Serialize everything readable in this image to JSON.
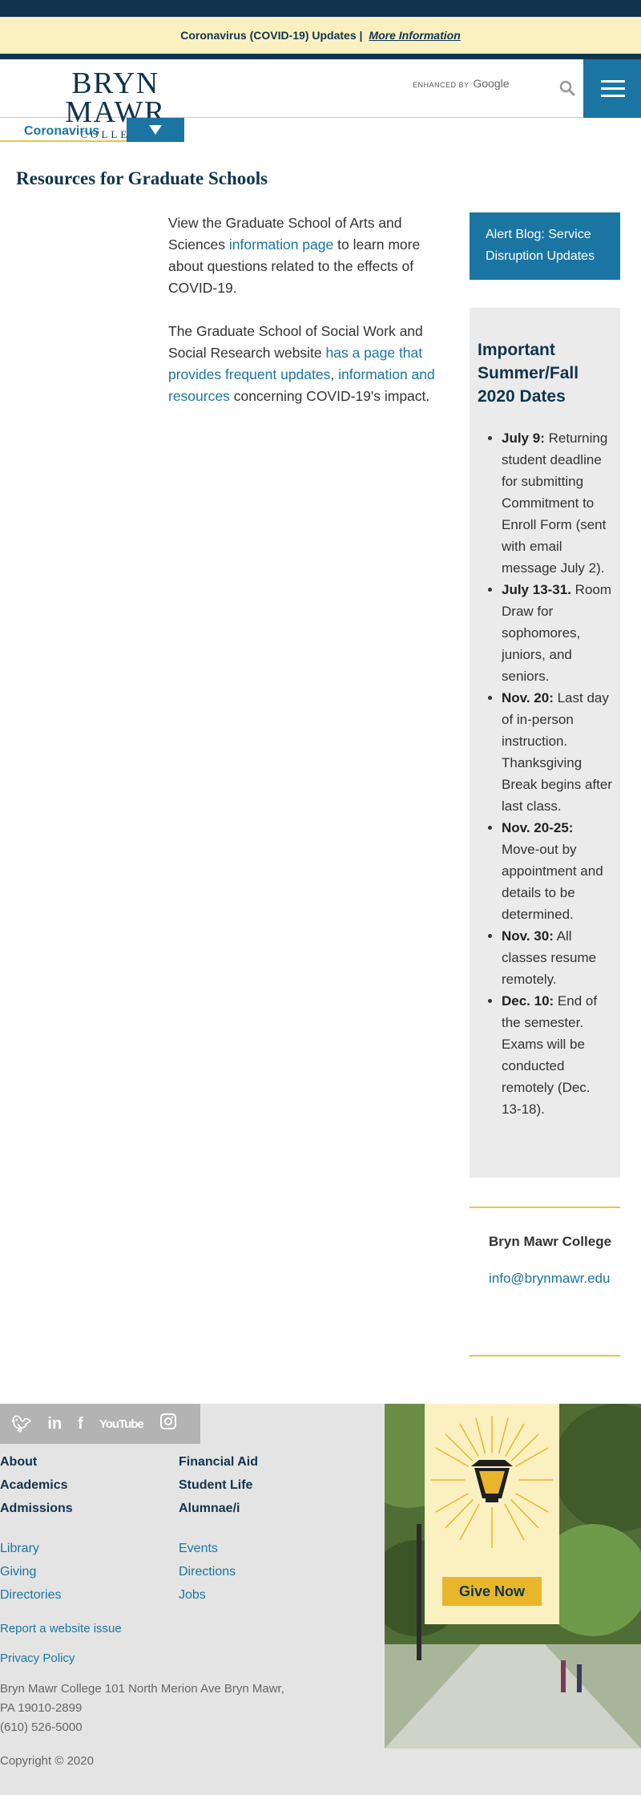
{
  "alert": {
    "text": "Coronavirus (COVID-19) Updates |",
    "link": "More Information"
  },
  "header": {
    "logo_line1": "BRYN MAWR",
    "logo_line2": "COLLEGE",
    "search_enhanced": "ENHANCED BY",
    "search_provider": "Google",
    "search_icon": "search-icon",
    "menu_icon": "hamburger-icon"
  },
  "subnav": {
    "label": "Coronavirus",
    "toggle_icon": "chevron-down-icon"
  },
  "page": {
    "title": "Resources for Graduate Schools"
  },
  "main": {
    "p1_before": "View the Graduate School of Arts and Sciences ",
    "p1_link": "information page",
    "p1_after": " to learn more about questions related to the effects of COVID-19.",
    "p2_before": "The Graduate School of Social Work and Social Research website ",
    "p2_link1": "has a page that provides frequent updates",
    "p2_sep": ", ",
    "p2_link2": "information and resources",
    "p2_after": " concerning COVID-19's impact."
  },
  "sidebar": {
    "blog_button": "Alert Blog: Service Disruption Updates",
    "dates_title": "Important Summer/Fall 2020 Dates",
    "dates": [
      {
        "date": "July 9:",
        "text": " Returning student deadline for submitting Commitment to Enroll Form (sent with email message July 2)."
      },
      {
        "date": "July 13-31.",
        "text": " Room Draw for sophomores, juniors, and seniors."
      },
      {
        "date": "Nov. 20:",
        "text": " Last day of in-person instruction. Thanksgiving Break begins after last class."
      },
      {
        "date": "Nov. 20-25:",
        "text": " Move-out by appointment and details to be determined."
      },
      {
        "date": "Nov. 30:",
        "text": " All classes resume remotely."
      },
      {
        "date": "Dec. 10:",
        "text": " End of the semester. Exams will be conducted remotely (Dec. 13-18)."
      }
    ],
    "contact_name": "Bryn Mawr College",
    "contact_email": "info@brynmawr.edu"
  },
  "footer": {
    "social": {
      "twitter": "twitter-icon",
      "linkedin": "linkedin-icon",
      "facebook": "facebook-icon",
      "youtube": "YouTube",
      "instagram": "instagram-icon"
    },
    "col1_bold": [
      "About",
      "Academics",
      "Admissions"
    ],
    "col2_bold": [
      "Financial Aid",
      "Student Life",
      "Alumnae/i"
    ],
    "col1_links": [
      "Library",
      "Giving",
      "Directories"
    ],
    "col2_links": [
      "Events",
      "Directions",
      "Jobs"
    ],
    "report_issue": "Report a website issue",
    "privacy": "Privacy Policy",
    "address_line1": "Bryn Mawr College 101 North Merion Ave Bryn Mawr,",
    "address_line2": "PA 19010-2899",
    "phone": "(610) 526-5000",
    "copyright": "Copyright © 2020",
    "give_button": "Give Now",
    "give_icon": "lantern-icon"
  },
  "colors": {
    "navy": "#10344e",
    "blue": "#1a75a3",
    "gold": "#e8c34a",
    "cream": "#fbf0c0"
  }
}
